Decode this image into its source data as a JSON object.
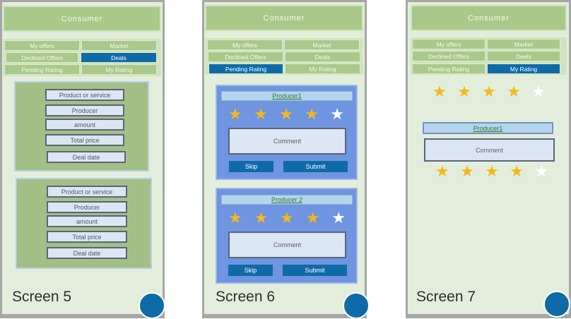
{
  "header": "Consumer",
  "tabs": {
    "my_offers": "My offers",
    "market": "Market",
    "declined_offers": "Declined Offers",
    "deals": "Deals",
    "pending_rating": "Pending Rating",
    "my_rating": "My Rating"
  },
  "deal_fields": {
    "product": "Product or service",
    "producer": "Producer",
    "amount": "amount",
    "total": "Total price",
    "date": "Deal date"
  },
  "screen6": {
    "producer1": "Producer1",
    "producer2": "Producer 2",
    "comment": "Comment",
    "skip": "Skip",
    "submit": "Submit"
  },
  "screen7": {
    "producer1": "Producer1",
    "comment": "Comment"
  },
  "ratings": {
    "filled_stars": 4,
    "total_stars": 5
  },
  "labels": {
    "s5": "Screen 5",
    "s6": "Screen 6",
    "s7": "Screen 7"
  },
  "colors": {
    "accent": "#0f6aa8",
    "header_green": "#a9c98a",
    "star": "#f5b71a"
  }
}
